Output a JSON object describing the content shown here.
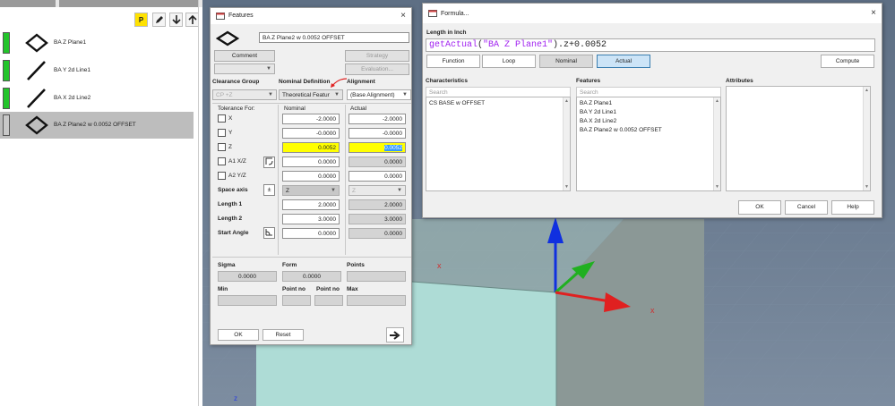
{
  "left_panel": {
    "toolbar": [
      "P",
      "pencil",
      "down",
      "up"
    ],
    "features": [
      {
        "label": "BA Z Plane1",
        "icon": "plane-icon",
        "status_color": "#22c42a"
      },
      {
        "label": "BA Y 2d Line1",
        "icon": "line-icon",
        "status_color": "#22c42a"
      },
      {
        "label": "BA X 2d Line2",
        "icon": "line-icon",
        "status_color": "#22c42a"
      },
      {
        "label": "BA Z Plane2 w 0.0052 OFFSET",
        "icon": "plane-icon",
        "status_color": "#c8c8c8",
        "selected": true
      }
    ]
  },
  "features_dialog": {
    "title": "Features",
    "name_value": "BA Z Plane2 w 0.0052 OFFSET",
    "comment_label": "Comment",
    "strategy_label": "Strategy",
    "evaluation_label": "Evaluation...",
    "clearance_group_label": "Clearance Group",
    "nominal_definition_label": "Nominal Definition",
    "alignment_label": "Alignment",
    "clearance_value": "CP +Z",
    "nominal_def_value": "Theoretical Featur",
    "alignment_value": "(Base Alignment)",
    "tolerance_for_label": "Tolerance For:",
    "nominal_col": "Nominal",
    "actual_col": "Actual",
    "rows": [
      {
        "label": "X",
        "nominal": "-2.0000",
        "actual": "-2.0000"
      },
      {
        "label": "Y",
        "nominal": "-0.0000",
        "actual": "-0.0000"
      },
      {
        "label": "Z",
        "nominal": "0.0052",
        "actual": "0.0052"
      },
      {
        "label": "A1 X/Z",
        "nominal": "0.0000",
        "actual": "0.0000"
      },
      {
        "label": "A2 Y/Z",
        "nominal": "0.0000",
        "actual": "0.0000"
      },
      {
        "label": "Space axis",
        "nominal": "Z",
        "actual": "Z"
      },
      {
        "label": "Length 1",
        "nominal": "2.0000",
        "actual": "2.0000"
      },
      {
        "label": "Length 2",
        "nominal": "3.0000",
        "actual": "3.0000"
      },
      {
        "label": "Start Angle",
        "nominal": "0.0000",
        "actual": "0.0000"
      }
    ],
    "space_axis_symbol": "±",
    "sigma_label": "Sigma",
    "form_label": "Form",
    "points_label": "Points",
    "sigma_value": "0.0000",
    "form_value": "0.0000",
    "min_label": "Min",
    "point_no_label": "Point no",
    "max_label": "Max",
    "ok_label": "OK",
    "reset_label": "Reset"
  },
  "formula_dialog": {
    "title": "Formula...",
    "length_label": "Length in Inch",
    "formula_func": "getActual",
    "formula_paren_open": "(",
    "formula_arg": "\"BA Z Plane1\"",
    "formula_rest": ").z+0.0052",
    "buttons": {
      "function": "Function",
      "loop": "Loop",
      "nominal": "Nominal",
      "actual": "Actual",
      "compute": "Compute"
    },
    "characteristics_label": "Characteristics",
    "features_label": "Features",
    "attributes_label": "Attributes",
    "search_placeholder": "Search",
    "characteristics": [
      "CS BASE w OFFSET"
    ],
    "features": [
      "BA Z Plane1",
      "BA Y 2d Line1",
      "BA X 2d Line2",
      "BA Z Plane2 w 0.0052 OFFSET"
    ],
    "ok_label": "OK",
    "cancel_label": "Cancel",
    "help_label": "Help"
  },
  "viewport": {
    "axis_mark": "x",
    "z_label": "z"
  },
  "colors": {
    "yellow_field": "#ffff00",
    "active_button": "#cce4f7",
    "green_status": "#22c42a"
  }
}
